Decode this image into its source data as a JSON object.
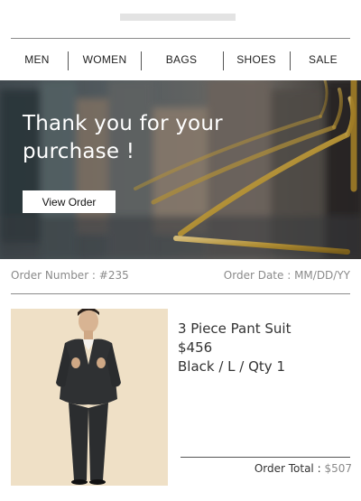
{
  "nav": {
    "items": [
      {
        "label": "MEN"
      },
      {
        "label": "WOMEN"
      },
      {
        "label": "BAGS"
      },
      {
        "label": "SHOES"
      },
      {
        "label": "SALE"
      }
    ]
  },
  "hero": {
    "title": "Thank you for your purchase !",
    "button_label": "View Order"
  },
  "order": {
    "number_text": "Order Number : #235",
    "date_text": "Order Date : MM/DD/YY"
  },
  "product": {
    "name": "3 Piece Pant Suit",
    "price": "$456",
    "variant": "Black / L / Qty 1"
  },
  "total": {
    "label": "Order Total : ",
    "value": "$507"
  },
  "colors": {
    "hero_overlay": "#3b4348",
    "hanger_gold": "#c9a23c",
    "product_bg": "#efe0c6",
    "muted_text": "#8a8a8a"
  }
}
